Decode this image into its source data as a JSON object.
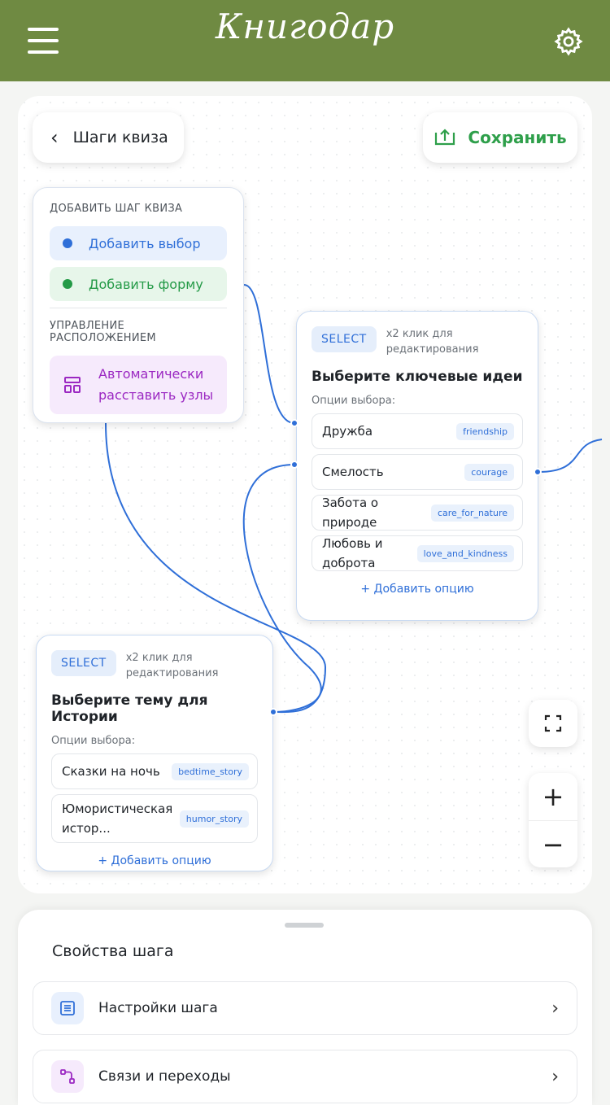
{
  "app": {
    "title": "Книгодар"
  },
  "icons": {
    "menu": "hamburger-icon",
    "settings": "gear-icon",
    "back": "chevron-left-icon",
    "save": "upload-icon",
    "layout": "layout-icon",
    "fullscreen": "fullscreen-icon",
    "zoom_in": "plus-icon",
    "zoom_out": "minus-icon"
  },
  "colors": {
    "header": "#6f8a42",
    "accent_blue": "#2f6fd8",
    "accent_green": "#2e9f4a",
    "accent_purple": "#9b28c2"
  },
  "toolbar": {
    "back_label": "Шаги квиза",
    "save_label": "Сохранить"
  },
  "panel": {
    "add_section": "ДОБАВИТЬ ШАГ КВИЗА",
    "add_choice": "Добавить выбор",
    "add_form": "Добавить форму",
    "layout_section": "УПРАВЛЕНИЕ РАСПОЛОЖЕНИЕМ",
    "auto_line1": "Автоматически",
    "auto_line2": "расставить узлы"
  },
  "nodes": [
    {
      "badge": "SELECT",
      "hint_line1": "x2 клик для",
      "hint_line2": "редактирования",
      "title": "Выберите ключевые идеи",
      "options_label": "Опции выбора:",
      "options": [
        {
          "label": "Дружба",
          "value": "friendship"
        },
        {
          "label": "Смелость",
          "value": "courage"
        },
        {
          "label": "Забота о природе",
          "value": "care_for_nature"
        },
        {
          "label": "Любовь и доброта",
          "value": "love_and_kindness"
        }
      ],
      "add_option": "+ Добавить опцию"
    },
    {
      "badge": "SELECT",
      "hint_line1": "x2 клик для",
      "hint_line2": "редактирования",
      "title": "Выберите тему для Истории",
      "options_label": "Опции выбора:",
      "options": [
        {
          "label": "Сказки на ночь",
          "value": "bedtime_story"
        },
        {
          "label": "Юмористическая истор...",
          "value": "humor_story"
        }
      ],
      "add_option": "+ Добавить опцию"
    }
  ],
  "zoom": {
    "in_label": "+",
    "out_label": "−"
  },
  "sheet": {
    "title": "Свойства шага",
    "items": [
      {
        "label": "Настройки шага"
      },
      {
        "label": "Связи и переходы"
      }
    ]
  }
}
